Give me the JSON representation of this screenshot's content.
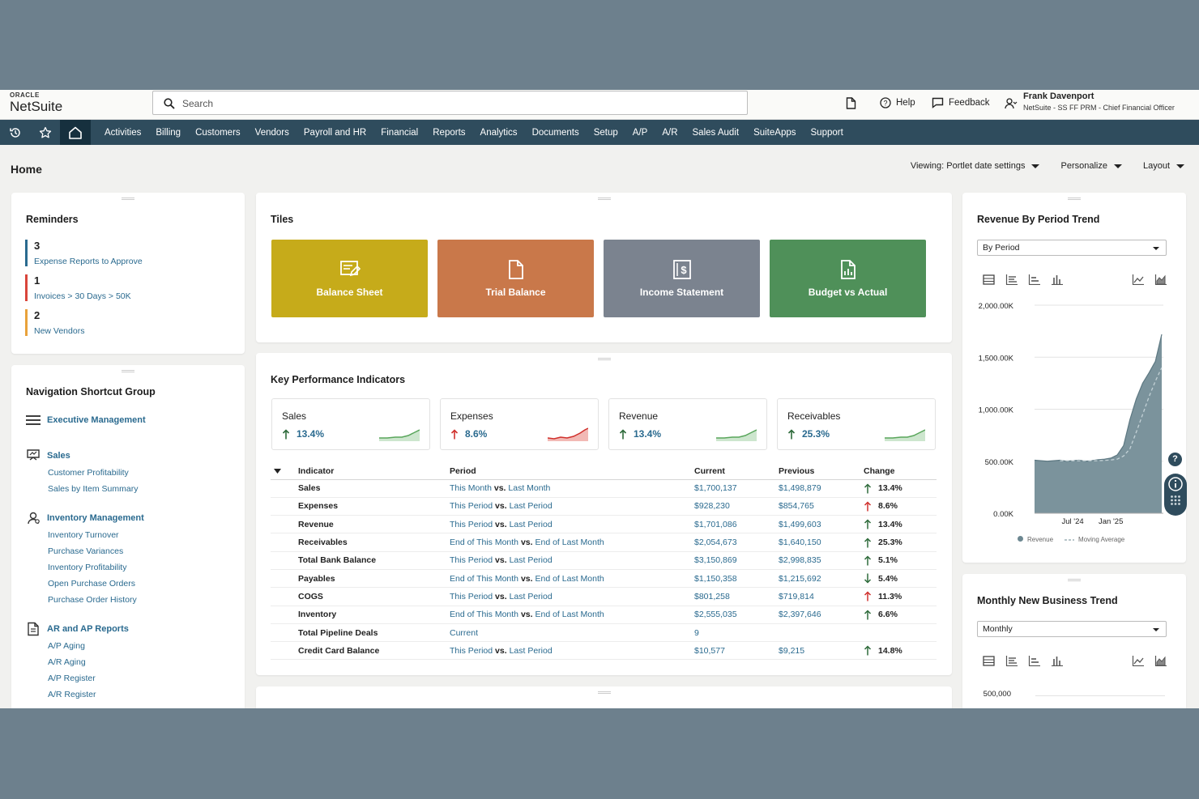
{
  "brand": {
    "oracle": "ORACLE",
    "product": "NetSuite"
  },
  "search": {
    "placeholder": "Search"
  },
  "topbar": {
    "help": "Help",
    "feedback": "Feedback",
    "user_name": "Frank Davenport",
    "user_role": "NetSuite - SS FF PRM - Chief Financial Officer"
  },
  "nav": {
    "items": [
      "Activities",
      "Billing",
      "Customers",
      "Vendors",
      "Payroll and HR",
      "Financial",
      "Reports",
      "Analytics",
      "Documents",
      "Setup",
      "A/P",
      "A/R",
      "Sales Audit",
      "SuiteApps",
      "Support"
    ]
  },
  "page": {
    "title": "Home",
    "viewing": "Viewing: Portlet date settings",
    "personalize": "Personalize",
    "layout": "Layout"
  },
  "reminders": {
    "title": "Reminders",
    "items": [
      {
        "count": "3",
        "label": "Expense Reports to Approve",
        "color": "#2a6a8f"
      },
      {
        "count": "1",
        "label": "Invoices > 30 Days > 50K",
        "color": "#d9453b"
      },
      {
        "count": "2",
        "label": "New Vendors",
        "color": "#e9a23b"
      }
    ]
  },
  "nav_shortcuts": {
    "title": "Navigation Shortcut Group",
    "executive": "Executive Management",
    "groups": [
      {
        "label": "Sales",
        "icon": "presentation-icon",
        "links": [
          "Customer Profitability",
          "Sales by Item Summary"
        ]
      },
      {
        "label": "Inventory Management",
        "icon": "user-badge-icon",
        "links": [
          "Inventory Turnover",
          "Purchase Variances",
          "Inventory Profitability",
          "Open Purchase Orders",
          "Purchase Order History"
        ]
      },
      {
        "label": "AR and AP Reports",
        "icon": "report-icon",
        "links": [
          "A/P Aging",
          "A/R Aging",
          "A/P Register",
          "A/R Register"
        ]
      }
    ]
  },
  "tiles": {
    "title": "Tiles",
    "items": [
      {
        "label": "Balance Sheet",
        "color": "#c6ab1a",
        "icon": "balance-sheet-icon"
      },
      {
        "label": "Trial Balance",
        "color": "#c9784a",
        "icon": "document-icon"
      },
      {
        "label": "Income Statement",
        "color": "#7b838f",
        "icon": "dollar-report-icon"
      },
      {
        "label": "Budget vs Actual",
        "color": "#4f9059",
        "icon": "chart-report-icon"
      }
    ]
  },
  "kpi": {
    "title": "Key Performance Indicators",
    "cards": [
      {
        "name": "Sales",
        "value": "13.4%",
        "dir": "up",
        "tone": "green"
      },
      {
        "name": "Expenses",
        "value": "8.6%",
        "dir": "up",
        "tone": "red"
      },
      {
        "name": "Revenue",
        "value": "13.4%",
        "dir": "up",
        "tone": "green"
      },
      {
        "name": "Receivables",
        "value": "25.3%",
        "dir": "up",
        "tone": "green"
      }
    ],
    "headers": [
      "Indicator",
      "Period",
      "Current",
      "Previous",
      "Change"
    ],
    "vs": "vs.",
    "rows": [
      {
        "indicator": "Sales",
        "p1": "This Month",
        "p2": "Last Month",
        "current": "$1,700,137",
        "previous": "$1,498,879",
        "change": "13.4%",
        "arrow": "up",
        "arrow_color": "#2d6a3a"
      },
      {
        "indicator": "Expenses",
        "p1": "This Period",
        "p2": "Last Period",
        "current": "$928,230",
        "previous": "$854,765",
        "change": "8.6%",
        "arrow": "up",
        "arrow_color": "#d0312d"
      },
      {
        "indicator": "Revenue",
        "p1": "This Period",
        "p2": "Last Period",
        "current": "$1,701,086",
        "previous": "$1,499,603",
        "change": "13.4%",
        "arrow": "up",
        "arrow_color": "#2d6a3a"
      },
      {
        "indicator": "Receivables",
        "p1": "End of This Month",
        "p2": "End of Last Month",
        "current": "$2,054,673",
        "previous": "$1,640,150",
        "change": "25.3%",
        "arrow": "up",
        "arrow_color": "#2d6a3a"
      },
      {
        "indicator": "Total Bank Balance",
        "p1": "This Period",
        "p2": "Last Period",
        "current": "$3,150,869",
        "previous": "$2,998,835",
        "change": "5.1%",
        "arrow": "up",
        "arrow_color": "#2d6a3a"
      },
      {
        "indicator": "Payables",
        "p1": "End of This Month",
        "p2": "End of Last Month",
        "current": "$1,150,358",
        "previous": "$1,215,692",
        "change": "5.4%",
        "arrow": "down",
        "arrow_color": "#2d6a3a"
      },
      {
        "indicator": "COGS",
        "p1": "This Period",
        "p2": "Last Period",
        "current": "$801,258",
        "previous": "$719,814",
        "change": "11.3%",
        "arrow": "up",
        "arrow_color": "#d0312d"
      },
      {
        "indicator": "Inventory",
        "p1": "End of This Month",
        "p2": "End of Last Month",
        "current": "$2,555,035",
        "previous": "$2,397,646",
        "change": "6.6%",
        "arrow": "up",
        "arrow_color": "#2d6a3a"
      },
      {
        "indicator": "Total Pipeline Deals",
        "p1": "Current",
        "p2": "",
        "current": "9",
        "previous": "",
        "change": "",
        "arrow": "",
        "arrow_color": ""
      },
      {
        "indicator": "Credit Card Balance",
        "p1": "This Period",
        "p2": "Last Period",
        "current": "$10,577",
        "previous": "$9,215",
        "change": "14.8%",
        "arrow": "up",
        "arrow_color": "#2d6a3a"
      }
    ]
  },
  "revenue_trend": {
    "title": "Revenue By Period Trend",
    "select": "By Period",
    "legend": [
      "Revenue",
      "Moving Average"
    ]
  },
  "monthly_trend": {
    "title": "Monthly New Business Trend",
    "select": "Monthly",
    "y_first_tick": "500,000"
  },
  "chart_data": {
    "type": "area",
    "title": "Revenue By Period Trend",
    "y_ticks": [
      "2,000.00K",
      "1,500.00K",
      "1,000.00K",
      "500.00K",
      "0.00K"
    ],
    "ylim": [
      0,
      2000
    ],
    "x_ticks": [
      "Jul '24",
      "Jan '25"
    ],
    "x_tick_index": [
      6,
      12
    ],
    "series": [
      {
        "name": "Revenue",
        "values": [
          510,
          505,
          500,
          505,
          510,
          500,
          505,
          510,
          500,
          505,
          515,
          520,
          530,
          560,
          650,
          900,
          1100,
          1250,
          1350,
          1460,
          1720
        ],
        "color": "#6c8791"
      },
      {
        "name": "Moving Average",
        "values": [
          null,
          null,
          null,
          null,
          505,
          505,
          505,
          505,
          505,
          505,
          505,
          508,
          512,
          520,
          550,
          620,
          780,
          950,
          1120,
          1270,
          1400
        ],
        "color": "#9fb2ba"
      }
    ],
    "grid": true,
    "legend_position": "bottom"
  }
}
